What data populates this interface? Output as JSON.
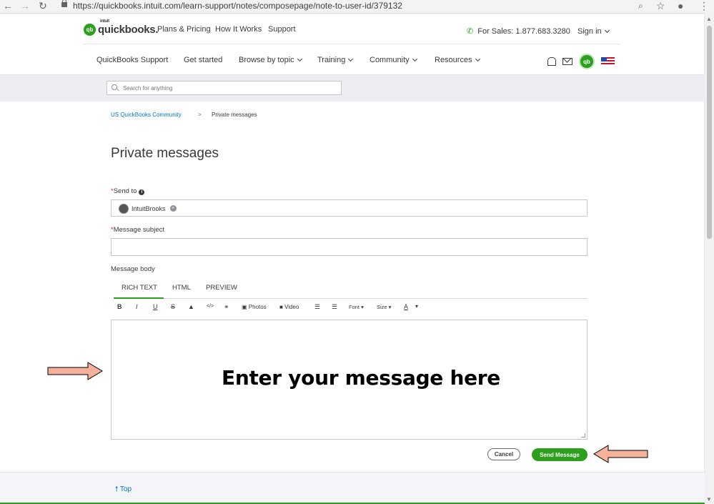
{
  "browser": {
    "url": "https://quickbooks.intuit.com/learn-support/notes/composepage/note-to-user-id/379132"
  },
  "header": {
    "logo_badge": "qb",
    "logo_small": "intuit",
    "logo_text": "quickbooks.",
    "links": [
      "Plans & Pricing",
      "How It Works",
      "Support"
    ],
    "sales": "For Sales: 1.877.683.3280",
    "sign_in": "Sign in"
  },
  "subnav": {
    "items": [
      "QuickBooks Support",
      "Get started",
      "Browse by topic",
      "Training",
      "Community",
      "Resources"
    ]
  },
  "search": {
    "placeholder": "Search for anything"
  },
  "breadcrumb": {
    "link": "US QuickBooks Community",
    "separator": ">",
    "current": "Private messages"
  },
  "page": {
    "title": "Private messages"
  },
  "form": {
    "send_to_label": "Send to",
    "required_mark": "*",
    "recipient": "IntuitBrooks",
    "subject_label": "Message subject",
    "body_label": "Message body",
    "tabs": [
      "RICH TEXT",
      "HTML",
      "PREVIEW"
    ],
    "toolbar": {
      "bold": "B",
      "italic": "I",
      "underline": "U",
      "strike": "S",
      "photos": "Photos",
      "video": "Video",
      "font": "Font",
      "size": "Size",
      "color": "A"
    },
    "cancel": "Cancel",
    "send": "Send Message"
  },
  "annotation": {
    "text": "Enter your message here"
  },
  "footer": {
    "top": "Top"
  },
  "colors": {
    "brand_green": "#2ca01c",
    "link_blue": "#0077c5",
    "arrow_fill": "#f4b19b"
  }
}
